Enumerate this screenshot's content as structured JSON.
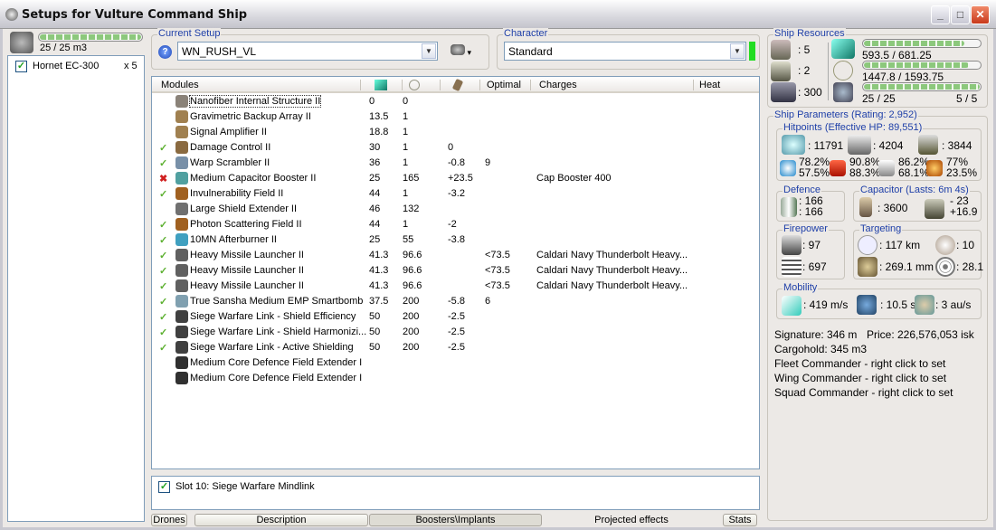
{
  "window": {
    "title": "Setups for Vulture Command Ship",
    "buttons": [
      "_",
      "□",
      "✕"
    ]
  },
  "drone_bay": {
    "usage": "25 / 25 m3",
    "fill": 1.0,
    "items": [
      {
        "name": "Hornet EC-300",
        "count": "x 5",
        "checked": true
      }
    ]
  },
  "current_setup": {
    "label": "Current Setup",
    "value": "WN_RUSH_VL",
    "help_icon": "help-icon",
    "drone_menu_icon": "drone-icon"
  },
  "character": {
    "label": "Character",
    "value": "Standard",
    "status_color": "#22dd22"
  },
  "modules": {
    "columns": [
      "Modules",
      "cpu-icon",
      "powergrid-icon",
      "capacitor-icon",
      "Optimal",
      "Charges",
      "Heat"
    ],
    "rows": [
      {
        "status": "",
        "name": "Nanofiber Internal Structure II",
        "cpu": "0",
        "pg": "0",
        "cap": "",
        "optimal": "",
        "charges": "",
        "color": "#8a8278"
      },
      {
        "status": "",
        "name": "Gravimetric Backup Array II",
        "cpu": "13.5",
        "pg": "1",
        "cap": "",
        "optimal": "",
        "charges": "",
        "color": "#a08050"
      },
      {
        "status": "",
        "name": "Signal Amplifier II",
        "cpu": "18.8",
        "pg": "1",
        "cap": "",
        "optimal": "",
        "charges": "",
        "color": "#a08050"
      },
      {
        "status": "active",
        "name": "Damage Control II",
        "cpu": "30",
        "pg": "1",
        "cap": "0",
        "optimal": "",
        "charges": "",
        "color": "#8a6a40"
      },
      {
        "status": "active",
        "name": "Warp Scrambler II",
        "cpu": "36",
        "pg": "1",
        "cap": "-0.8",
        "optimal": "9",
        "charges": "",
        "color": "#7890a8"
      },
      {
        "status": "offline",
        "name": "Medium Capacitor Booster II",
        "cpu": "25",
        "pg": "165",
        "cap": "+23.5",
        "optimal": "",
        "charges": "Cap Booster 400",
        "color": "#50a0a0"
      },
      {
        "status": "active",
        "name": "Invulnerability Field II",
        "cpu": "44",
        "pg": "1",
        "cap": "-3.2",
        "optimal": "",
        "charges": "",
        "color": "#a06020"
      },
      {
        "status": "",
        "name": "Large Shield Extender II",
        "cpu": "46",
        "pg": "132",
        "cap": "",
        "optimal": "",
        "charges": "",
        "color": "#707070"
      },
      {
        "status": "active",
        "name": "Photon Scattering Field II",
        "cpu": "44",
        "pg": "1",
        "cap": "-2",
        "optimal": "",
        "charges": "",
        "color": "#a06020"
      },
      {
        "status": "active",
        "name": "10MN Afterburner II",
        "cpu": "25",
        "pg": "55",
        "cap": "-3.8",
        "optimal": "",
        "charges": "",
        "color": "#40a0c0"
      },
      {
        "status": "active",
        "name": "Heavy Missile Launcher II",
        "cpu": "41.3",
        "pg": "96.6",
        "cap": "",
        "optimal": "<73.5",
        "charges": "Caldari Navy Thunderbolt Heavy...",
        "color": "#606060"
      },
      {
        "status": "active",
        "name": "Heavy Missile Launcher II",
        "cpu": "41.3",
        "pg": "96.6",
        "cap": "",
        "optimal": "<73.5",
        "charges": "Caldari Navy Thunderbolt Heavy...",
        "color": "#606060"
      },
      {
        "status": "active",
        "name": "Heavy Missile Launcher II",
        "cpu": "41.3",
        "pg": "96.6",
        "cap": "",
        "optimal": "<73.5",
        "charges": "Caldari Navy Thunderbolt Heavy...",
        "color": "#606060"
      },
      {
        "status": "active",
        "name": "True Sansha Medium EMP Smartbomb",
        "cpu": "37.5",
        "pg": "200",
        "cap": "-5.8",
        "optimal": "6",
        "charges": "",
        "color": "#80a0b0"
      },
      {
        "status": "active",
        "name": "Siege Warfare Link - Shield Efficiency",
        "cpu": "50",
        "pg": "200",
        "cap": "-2.5",
        "optimal": "",
        "charges": "",
        "color": "#404040"
      },
      {
        "status": "active",
        "name": "Siege Warfare Link - Shield Harmonizi...",
        "cpu": "50",
        "pg": "200",
        "cap": "-2.5",
        "optimal": "",
        "charges": "",
        "color": "#404040"
      },
      {
        "status": "active",
        "name": "Siege Warfare Link - Active Shielding",
        "cpu": "50",
        "pg": "200",
        "cap": "-2.5",
        "optimal": "",
        "charges": "",
        "color": "#404040"
      },
      {
        "status": "",
        "name": "Medium Core Defence Field Extender I",
        "cpu": "",
        "pg": "",
        "cap": "",
        "optimal": "",
        "charges": "",
        "color": "#303030"
      },
      {
        "status": "",
        "name": "Medium Core Defence Field Extender I",
        "cpu": "",
        "pg": "",
        "cap": "",
        "optimal": "",
        "charges": "",
        "color": "#303030"
      }
    ]
  },
  "implants": {
    "items": [
      {
        "label": "Slot 10: Siege Warfare Mindlink",
        "checked": true
      }
    ]
  },
  "tabs": [
    "Drones",
    "Description",
    "Boosters\\Implants",
    "Projected effects",
    "Stats"
  ],
  "resources": {
    "label": "Ship Resources",
    "turrets": ": 5",
    "launchers": ": 2",
    "calibration": ": 300",
    "cpu": {
      "text": "593.5 / 681.25",
      "fill": 0.871
    },
    "powergrid": {
      "text": "1447.8 / 1593.75",
      "fill": 0.908
    },
    "drone_bandwidth": {
      "text": "25 / 25",
      "fill": 1.0
    },
    "drones": "5 / 5"
  },
  "parameters": {
    "label": "Ship Parameters (Rating: 2,952)",
    "hitpoints": {
      "label": "Hitpoints (Effective HP: 89,551)",
      "shield": ": 11791",
      "armor": ": 4204",
      "structure": ": 3844",
      "resists": [
        [
          "78.2%",
          "57.5%"
        ],
        [
          "90.8%",
          "88.3%"
        ],
        [
          "86.2%",
          "68.1%"
        ],
        [
          "77%",
          "23.5%"
        ]
      ]
    },
    "defence": {
      "label": "Defence",
      "a": ": 166",
      "b": ": 166"
    },
    "capacitor": {
      "label": "Capacitor (Lasts: 6m 4s)",
      "capacity": ": 3600",
      "use": "- 23",
      "recharge": "+16.9"
    },
    "firepower": {
      "label": "Firepower",
      "dps": ": 97",
      "volley": ": 697"
    },
    "targeting": {
      "label": "Targeting",
      "range": ": 117 km",
      "targets": ": 10",
      "scan": ": 269.1 mm",
      "sensor": ": 28.1"
    },
    "mobility": {
      "label": "Mobility",
      "speed": ": 419 m/s",
      "align": ": 10.5 s",
      "warp": ": 3 au/s"
    },
    "signature": "Signature: 346 m",
    "price": "Price: 226,576,053 isk",
    "cargo": "Cargohold: 345 m3",
    "fleet": "Fleet Commander - right click to set",
    "wing": "Wing Commander - right click to set",
    "squad": "Squad Commander - right click to set"
  }
}
